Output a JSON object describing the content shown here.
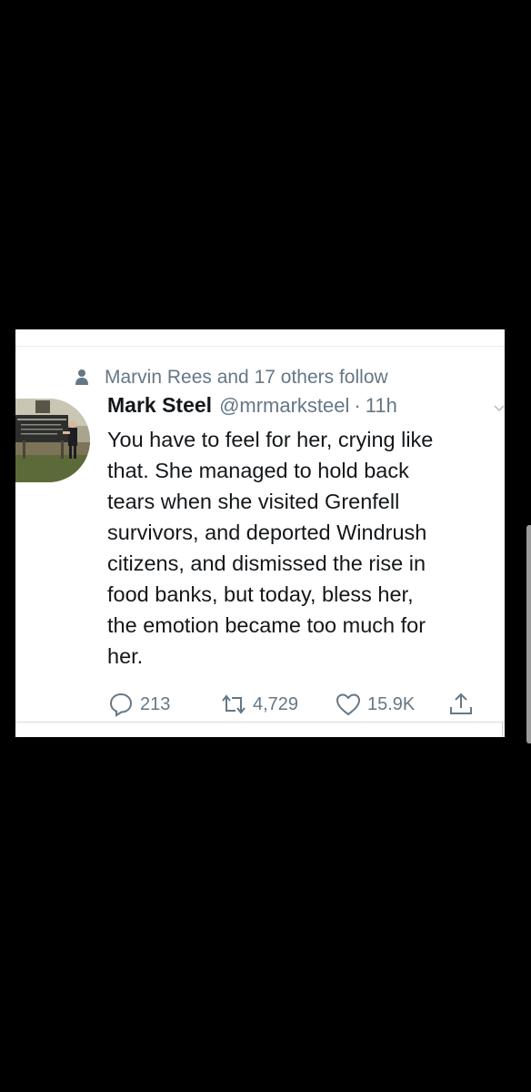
{
  "social_context": {
    "text": "Marvin Rees and 17 others follow",
    "icon": "person-icon"
  },
  "tweet": {
    "display_name": "Mark Steel",
    "handle": "@mrmarksteel",
    "separator": "·",
    "time": "11h",
    "text": "You have to feel for her, crying like\nthat. She managed to hold back\ntears when she visited Grenfell\nsurvivors, and deported Windrush\ncitizens, and dismissed the rise in\nfood banks, but today, bless her,\nthe emotion became too much for\nher.",
    "avatar_icon": "avatar-photo"
  },
  "actions": {
    "replies": "213",
    "retweets": "4,729",
    "likes": "15.9K",
    "icons": [
      "reply-icon",
      "retweet-icon",
      "like-icon",
      "share-icon"
    ]
  },
  "colors": {
    "background": "#000000",
    "card": "#ffffff",
    "primary_text": "#14171a",
    "secondary_text": "#657786"
  }
}
